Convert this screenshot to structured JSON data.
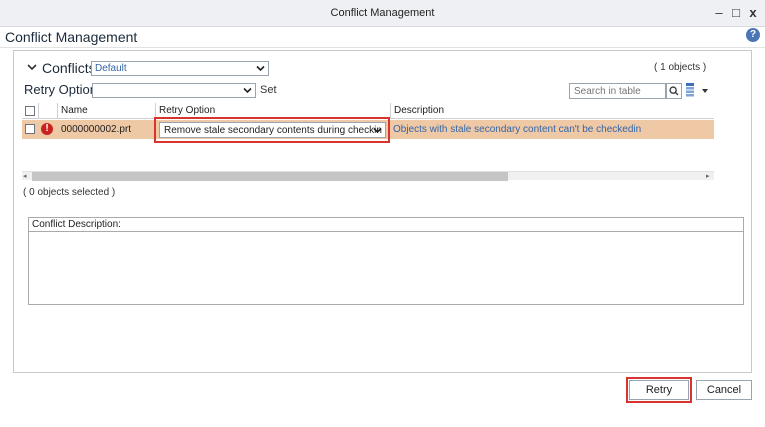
{
  "window": {
    "title": "Conflict Management",
    "minimize": "–",
    "maximize": "□",
    "close": "x"
  },
  "header": {
    "title": "Conflict Management",
    "help": "?"
  },
  "conflicts": {
    "title": "Conflicts",
    "filter_value": "Default",
    "object_count": "( 1 objects )"
  },
  "retry_option": {
    "title": "Retry Option",
    "value": "",
    "set_label": "Set"
  },
  "search": {
    "placeholder": "Search in table"
  },
  "table": {
    "columns": [
      "Name",
      "Retry Option",
      "Description"
    ],
    "rows": [
      {
        "name": "0000000002.prt",
        "retry_option": "Remove stale secondary contents during checkin",
        "description": "Objects with stale secondary content can't be checkedin"
      }
    ],
    "selected_count": "( 0 objects selected )"
  },
  "conflict_description": {
    "label": "Conflict Description:"
  },
  "buttons": {
    "retry": "Retry",
    "cancel": "Cancel"
  },
  "colors": {
    "row_highlight": "#efc8a5",
    "accent_red": "#d8332e",
    "link_blue": "#3366a8"
  },
  "icons": [
    "chevron-down-icon",
    "error-icon",
    "search-icon",
    "column-grid-icon",
    "dropdown-arrow-icon",
    "help-icon"
  ]
}
